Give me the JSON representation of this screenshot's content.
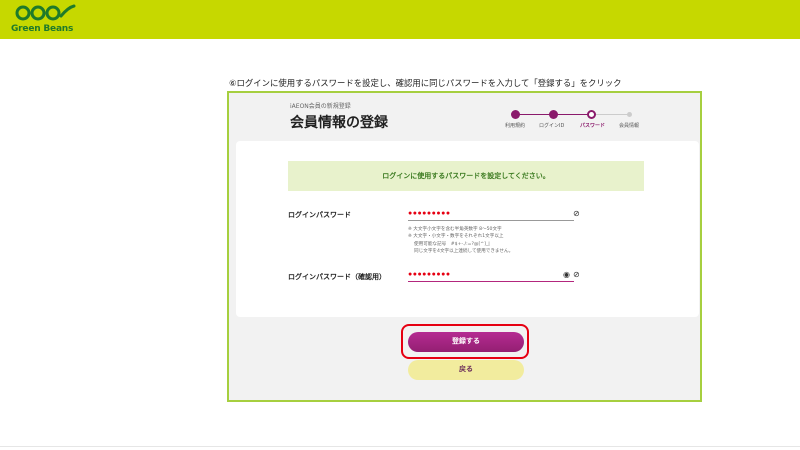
{
  "header": {
    "logo_text": "Green Beans",
    "brand_color": "#c6d800"
  },
  "instruction_text": "⑥ログインに使用するパスワードを設定し、確認用に同じパスワードを入力して「登録する」をクリック",
  "page": {
    "subtitle": "iAEON会員の新規登録",
    "title": "会員情報の登録"
  },
  "stepper": {
    "steps": [
      {
        "label": "利用規約",
        "state": "done"
      },
      {
        "label": "ログインID",
        "state": "done"
      },
      {
        "label": "パスワード",
        "state": "current"
      },
      {
        "label": "会員情報",
        "state": "todo"
      }
    ],
    "active_color": "#8a1a6b"
  },
  "form": {
    "notice": "ログインに使用するパスワードを設定してください。",
    "password_label": "ログインパスワード",
    "password_value": "●●●●●●●●●",
    "confirm_label": "ログインパスワード（確認用）",
    "confirm_value": "●●●●●●●●●",
    "hints": [
      "※ 大文字小文字を含む半角英数字 8～50文字",
      "※ 大文字・小文字・数字をそれぞれ1文字以上",
      "　 使用可能な記号　#$+-./:=?@[^]_|",
      "　 同じ文字を4文字以上連続して使用できません。"
    ]
  },
  "buttons": {
    "register": "登録する",
    "back": "戻る"
  }
}
